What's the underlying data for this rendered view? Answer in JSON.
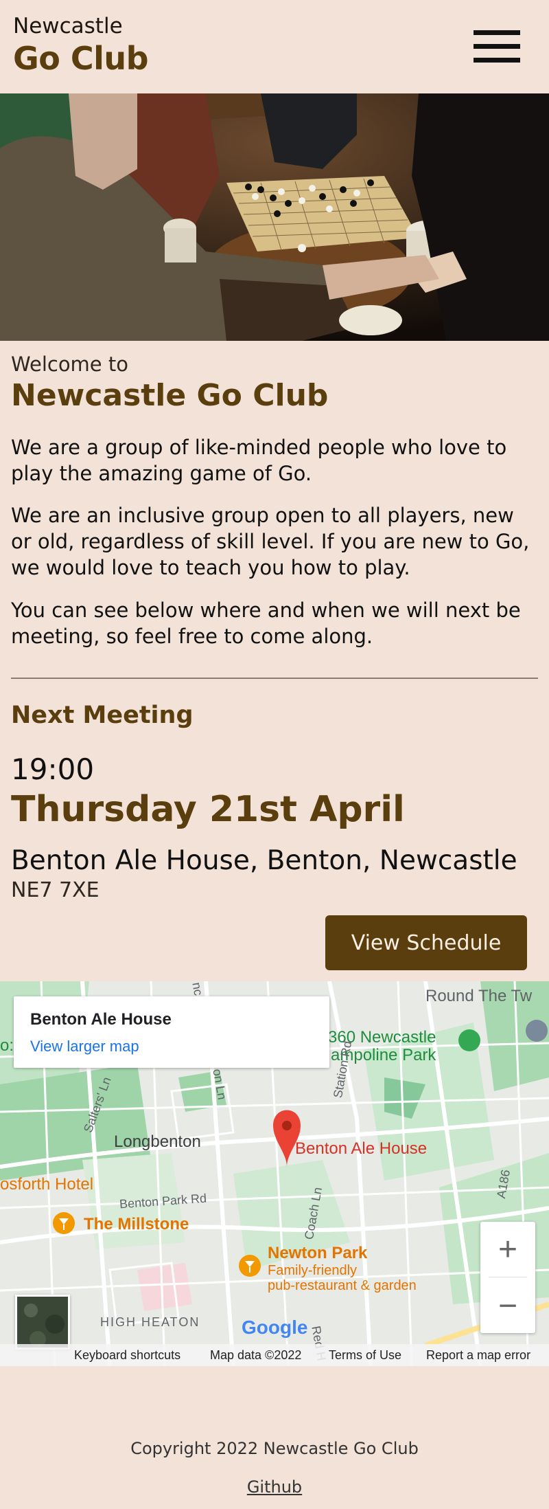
{
  "header": {
    "brand_top": "Newcastle",
    "brand_main": "Go Club",
    "menu_icon": "hamburger-menu-icon"
  },
  "hero": {
    "image": "photo of people playing Go at a round wooden table"
  },
  "welcome": {
    "small": "Welcome to",
    "title": "Newcastle Go Club",
    "paragraphs": [
      "We are a group of like-minded people who love to play the amazing game of Go.",
      "We are an inclusive group open to all players, new or old, regardless of skill level. If you are new to Go, we would love to teach you how to play.",
      "You can see below where and when we will next be meeting, so feel free to come along."
    ]
  },
  "next_meeting": {
    "heading": "Next Meeting",
    "time": "19:00",
    "date": "Thursday 21st April",
    "venue": "Benton Ale House, Benton, Newcastle",
    "postcode": "NE7 7XE",
    "schedule_button": "View Schedule"
  },
  "map": {
    "card_title": "Benton Ale House",
    "card_link": "View larger map",
    "labels": {
      "round_the_twist": "Round The Tw",
      "trampoline_1": "360 Newcastle",
      "trampoline_2": "ampoline Park",
      "longbenton": "Longbenton",
      "marker_label": "Benton Ale House",
      "gosforth": "osforth Hotel",
      "benton_park_rd": "Benton Park Rd",
      "millstone": "The Millstone",
      "newton_park": "Newton Park",
      "newton_desc_1": "Family-friendly",
      "newton_desc_2": "pub-restaurant & garden",
      "high_heaton": "HIGH HEATON",
      "station_rd": "Station Rd",
      "coach_ln": "Coach Ln",
      "saltwell": "Salters' Ln",
      "a186": "A186",
      "red_hall": "Red H",
      "google": "Google",
      "nc": "nc",
      "on_ln": "on Ln",
      "o_left": "o:"
    },
    "zoom_in": "+",
    "zoom_out": "−",
    "footer": {
      "shortcuts": "Keyboard shortcuts",
      "map_data": "Map data ©2022",
      "terms": "Terms of Use",
      "report": "Report a map error"
    },
    "colors": {
      "marker": "#ea4335",
      "poi_orange": "#f29900",
      "park_green": "#c8e6c9",
      "road": "#ffffff"
    }
  },
  "footer": {
    "copyright": "Copyright 2022 Newcastle Go Club",
    "github": "Github"
  },
  "colors": {
    "background": "#f2e2d7",
    "brand_brown": "#5a3e0e"
  }
}
